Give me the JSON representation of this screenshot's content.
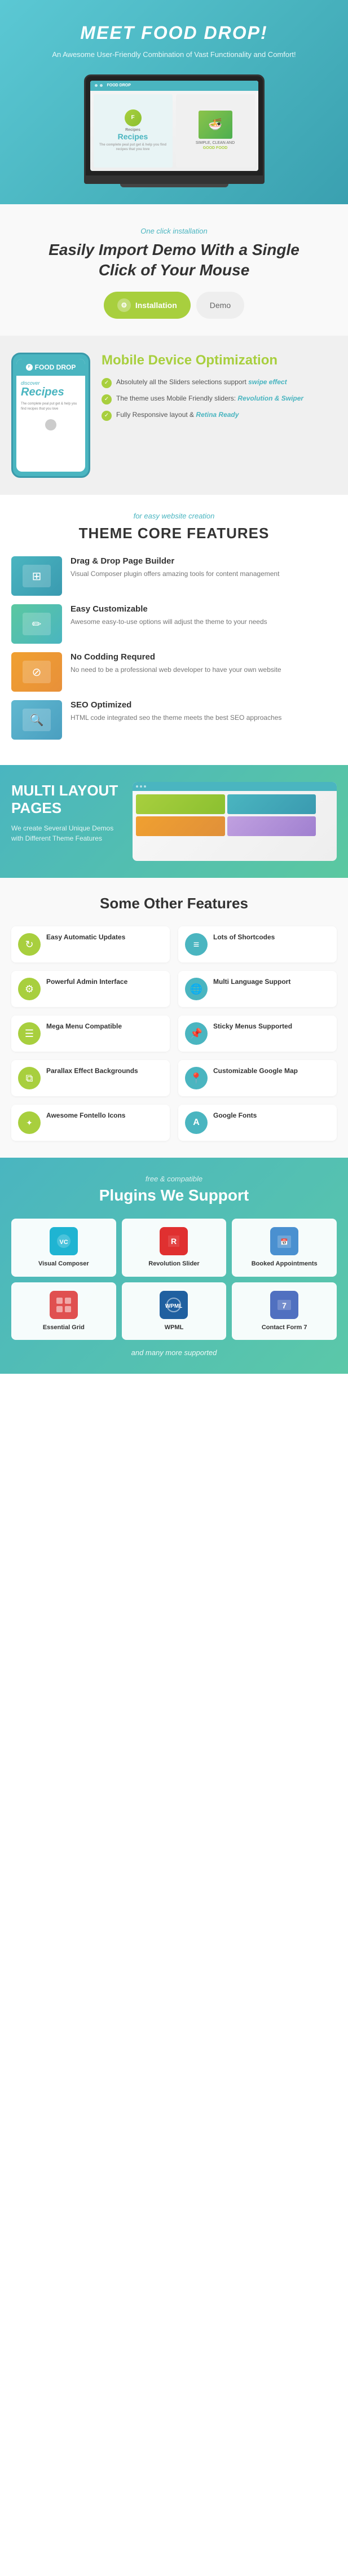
{
  "hero": {
    "title": "Meet Food Drop!",
    "subtitle": "An Awesome User-Friendly Combination of Vast Functionality and Comfort!"
  },
  "installation": {
    "label": "One click installation",
    "title_line1": "Easily Import Demo With a Single",
    "title_line2": "Click of Your Mouse",
    "btn_label": "Installation"
  },
  "mobile_optimization": {
    "label": "Mobile Device Optimization",
    "features": [
      {
        "text": "Absolutely all the Sliders selections support swipe effect"
      },
      {
        "text": "The theme uses Mobile Friendly sliders: Revolution & Swiper"
      },
      {
        "text": "Fully Responsive layout & Retina Ready"
      }
    ]
  },
  "core_features": {
    "section_label": "for easy website creation",
    "title": "Theme Core Features",
    "items": [
      {
        "title": "Drag & Drop Page Builder",
        "desc": "Visual Composer plugin offers amazing tools for content management"
      },
      {
        "title": "Easy Customizable",
        "desc": "Awesome easy-to-use options will adjust the theme to your needs"
      },
      {
        "title": "No Codding Requred",
        "desc": "No need to be a professional web developer to have your own website"
      },
      {
        "title": "SEO Optimized",
        "desc": "HTML code integrated seo the theme meets the best SEO approaches"
      }
    ]
  },
  "multi_layout": {
    "title": "Multi Layout Pages",
    "desc": "We create Several Unique Demos with Different Theme Features"
  },
  "other_features": {
    "title": "Some Other Features",
    "items": [
      {
        "icon": "↻",
        "color": "icon-green",
        "title": "Easy Automatic Updates"
      },
      {
        "icon": "≡",
        "color": "icon-teal",
        "title": "Lots of Shortcodes"
      },
      {
        "icon": "⚙",
        "color": "icon-green",
        "title": "Powerful Admin Interface"
      },
      {
        "icon": "🌐",
        "color": "icon-teal",
        "title": "Multi Language Support"
      },
      {
        "icon": "☰",
        "color": "icon-green",
        "title": "Mega Menu Compatible"
      },
      {
        "icon": "📌",
        "color": "icon-teal",
        "title": "Sticky Menus Supported"
      },
      {
        "icon": "⧉",
        "color": "icon-green",
        "title": "Parallax Effect Backgrounds"
      },
      {
        "icon": "📍",
        "color": "icon-teal",
        "title": "Customizable Google Map"
      },
      {
        "icon": "✦",
        "color": "icon-green",
        "title": "Awesome Fontello Icons"
      },
      {
        "icon": "A",
        "color": "icon-teal",
        "title": "Google Fonts"
      }
    ]
  },
  "plugins": {
    "label": "free & compatible",
    "title": "Plugins We Support",
    "items": [
      {
        "name": "Visual Composer",
        "icon": "VC",
        "color": "plugin-vc"
      },
      {
        "name": "Revolution Slider",
        "icon": "R",
        "color": "plugin-rev"
      },
      {
        "name": "Booked Appointments",
        "icon": "📅",
        "color": "plugin-ba"
      },
      {
        "name": "Essential Grid",
        "icon": "⊞",
        "color": "plugin-es"
      },
      {
        "name": "WPML",
        "icon": "W",
        "color": "plugin-wpml"
      },
      {
        "name": "Contact Form 7",
        "icon": "7",
        "color": "plugin-cf"
      }
    ],
    "footer": "and many more supported"
  }
}
